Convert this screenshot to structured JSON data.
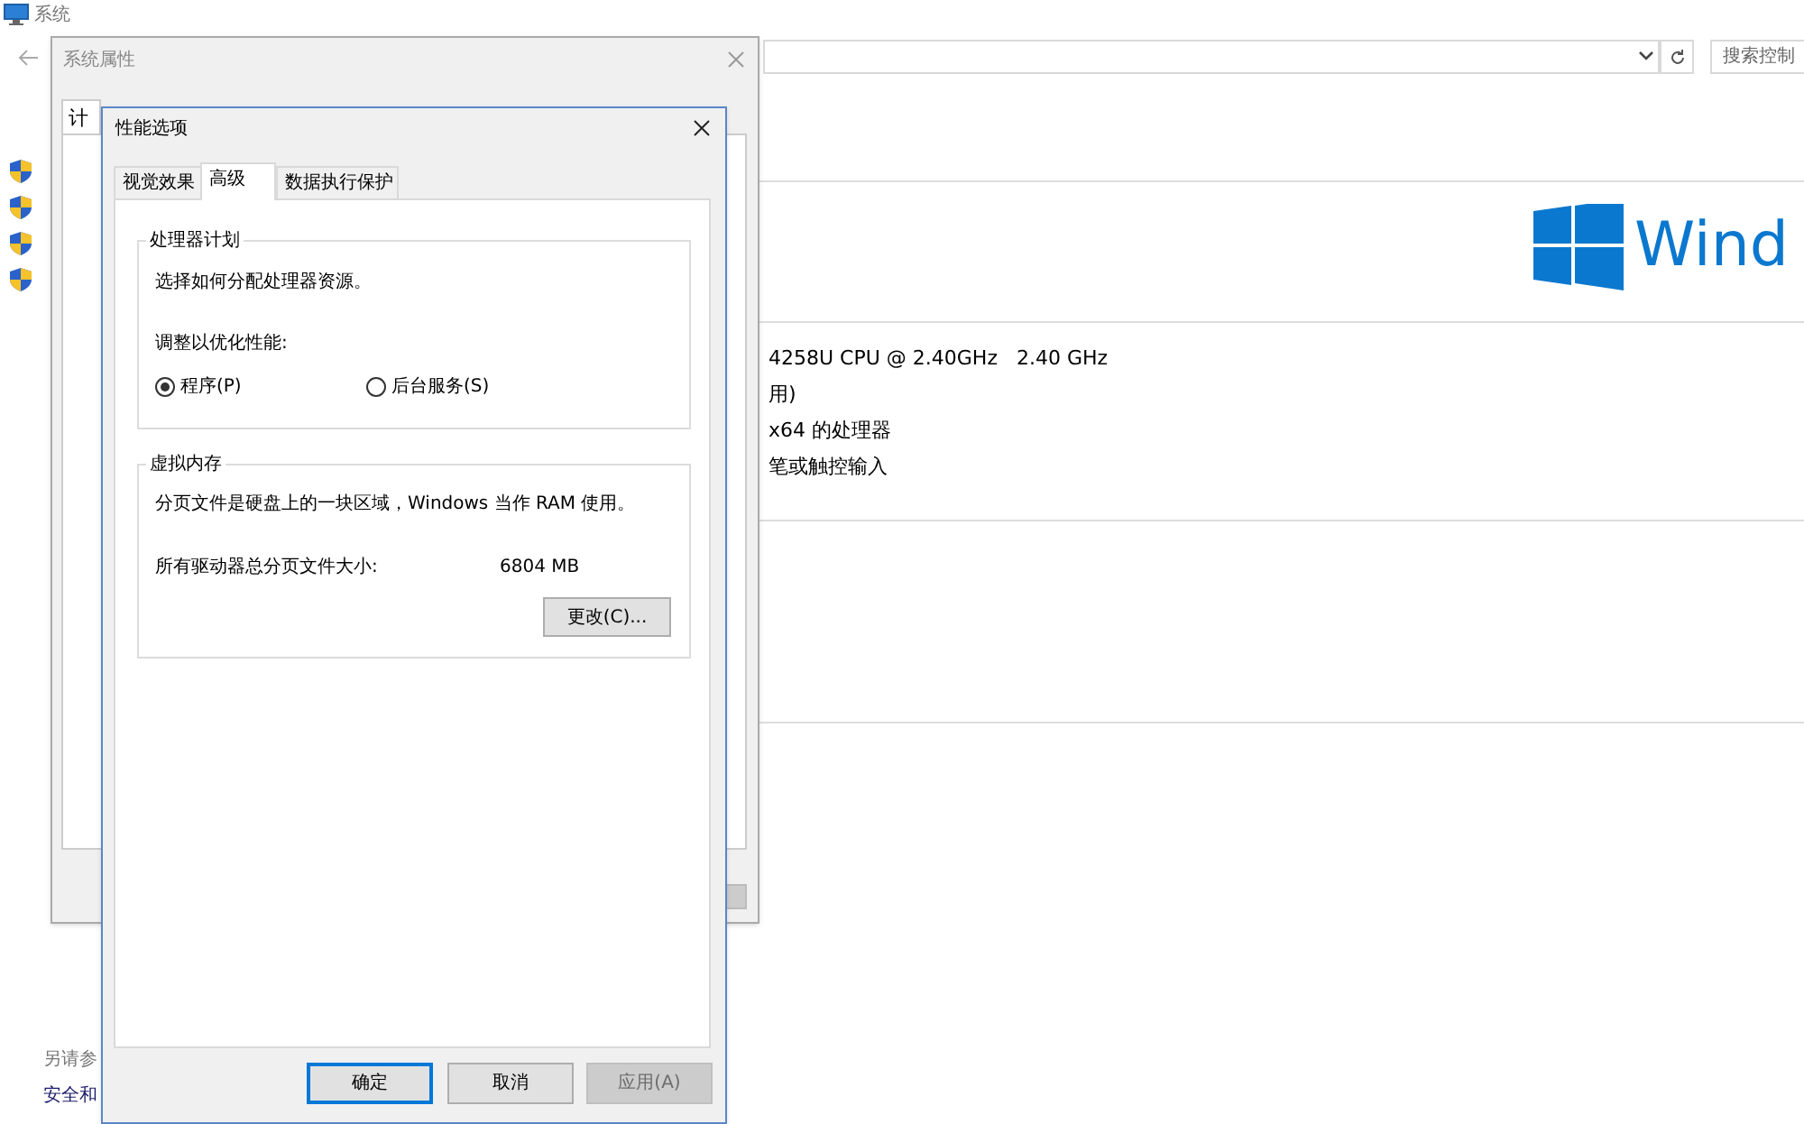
{
  "system_window": {
    "title": "系统",
    "search": {
      "placeholder": "搜索控制"
    },
    "logo_text": "Wind",
    "spec_lines": [
      "4258U CPU @ 2.40GHz   2.40 GHz",
      "用)",
      "x64 的处理器",
      "笔或触控输入"
    ],
    "see_also": {
      "heading": "另请参",
      "link": "安全和"
    }
  },
  "system_properties": {
    "title": "系统属性",
    "tab": "计"
  },
  "performance_options": {
    "title": "性能选项",
    "tabs": [
      {
        "label": "视觉效果",
        "selected": false
      },
      {
        "label": "高级",
        "selected": true
      },
      {
        "label": "数据执行保护",
        "selected": false
      }
    ],
    "processor_group": {
      "legend": "处理器计划",
      "description": "选择如何分配处理器资源。",
      "prompt": "调整以优化性能:",
      "options": [
        {
          "label": "程序(P)",
          "selected": true
        },
        {
          "label": "后台服务(S)",
          "selected": false
        }
      ]
    },
    "memory_group": {
      "legend": "虚拟内存",
      "description": "分页文件是硬盘上的一块区域，Windows 当作 RAM 使用。",
      "size_label": "所有驱动器总分页文件大小:",
      "size_value": "6804 MB",
      "change_button": "更改(C)..."
    },
    "buttons": [
      {
        "label": "确定",
        "default": true,
        "disabled": false
      },
      {
        "label": "取消",
        "default": false,
        "disabled": false
      },
      {
        "label": "应用(A)",
        "default": false,
        "disabled": true
      }
    ]
  }
}
